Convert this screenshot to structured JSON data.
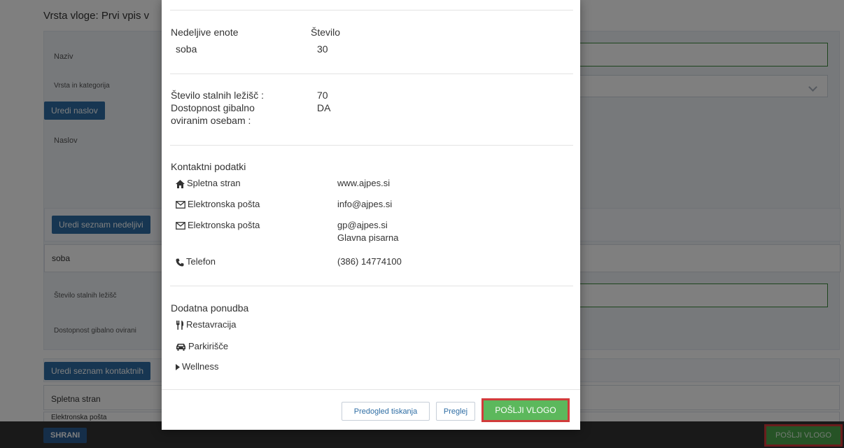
{
  "background": {
    "heading": "Vrsta vloge: Prvi vpis v",
    "form": {
      "name_label": "Naziv",
      "category_label": "Vrsta in kategorija",
      "edit_address_button": "Uredi naslov",
      "address_label": "Naslov",
      "edit_units_button": "Uredi seznam nedeljivi",
      "unit_row": "soba",
      "beds_label": "Število stalnih ležišč",
      "accessibility_label": "Dostopnost gibalno ovirani",
      "edit_contacts_button": "Uredi seznam kontaktnih",
      "contact_row_website": "Spletna stran",
      "contact_row_email_partial": "Elektronska pošta"
    },
    "save_button": "SHRANI",
    "submit_button": "POŠLJI VLOGO"
  },
  "modal": {
    "units": {
      "header_left": "Nedeljive enote",
      "header_right": "Število",
      "unit_name": "soba",
      "unit_count": "30"
    },
    "details": {
      "beds_label": "Število stalnih ležišč :",
      "beds_value": "70",
      "accessibility_label_line1": "Dostopnost gibalno",
      "accessibility_label_line2": "oviranim osebam :",
      "accessibility_value": "DA"
    },
    "contacts": {
      "title": "Kontaktni podatki",
      "website_label": "Spletna stran",
      "website_value": "www.ajpes.si",
      "email1_label": "Elektronska pošta",
      "email1_value": "info@ajpes.si",
      "email2_label": "Elektronska pošta",
      "email2_value": "gp@ajpes.si",
      "email2_note": "Glavna pisarna",
      "phone_label": "Telefon",
      "phone_value": "(386) 14774100"
    },
    "extras": {
      "title": "Dodatna ponudba",
      "item1": "Restavracija",
      "item2": "Parkirišče",
      "item3": "Wellness"
    },
    "footer": {
      "print_preview_button": "Predogled tiskanja",
      "check_button": "Preglej",
      "submit_button": "POŠLJI VLOGO"
    }
  },
  "colors": {
    "primary": "#2e6da4",
    "success": "#5cb85c",
    "highlight": "#d23b3b",
    "bottom_bar": "#333333"
  }
}
